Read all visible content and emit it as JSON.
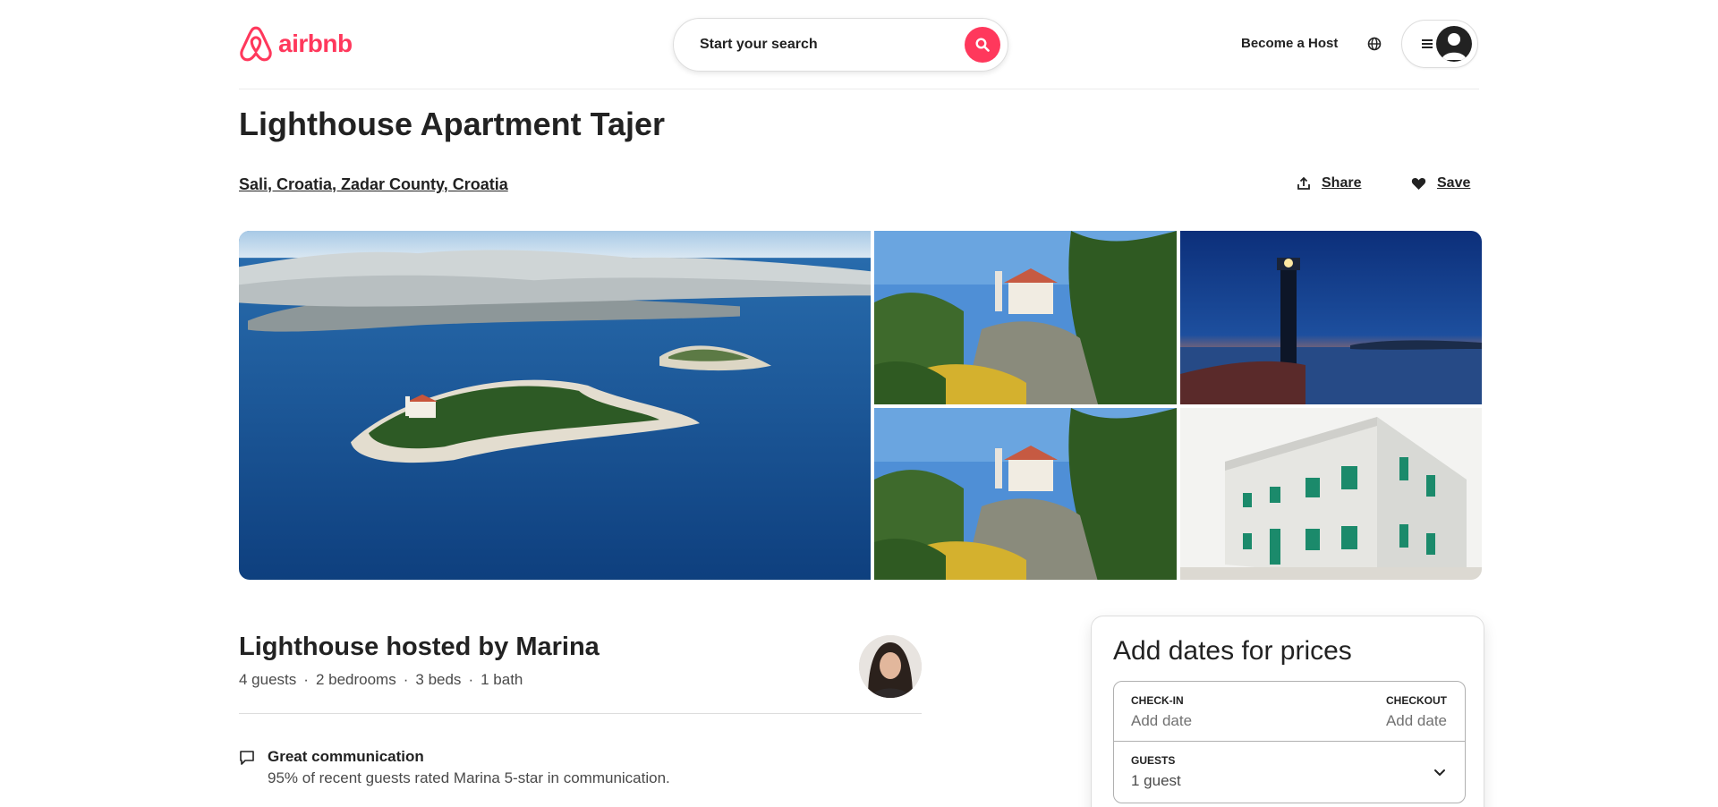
{
  "header": {
    "logo_text": "airbnb",
    "search_label": "Start your search",
    "host_link": "Become a Host"
  },
  "listing": {
    "title": "Lighthouse Apartment Tajer",
    "location": "Sali, Croatia, Zadar County, Croatia",
    "share_label": "Share",
    "save_label": "Save"
  },
  "host": {
    "title": "Lighthouse hosted by Marina",
    "details": [
      "4 guests",
      "·",
      "2 bedrooms",
      "·",
      "3 beds",
      "·",
      "1 bath"
    ],
    "highlight_title": "Great communication",
    "highlight_desc": "95% of recent guests rated Marina 5-star in communication."
  },
  "booking": {
    "title": "Add dates for prices",
    "checkin_label": "CHECK-IN",
    "checkin_value": "Add date",
    "checkout_label": "CHECKOUT",
    "checkout_value": "Add date",
    "guests_label": "GUESTS",
    "guests_value": "1 guest"
  },
  "colors": {
    "brand": "#ff385c",
    "text": "#222222",
    "muted": "#717171"
  },
  "icons": [
    "airbnb-logo-icon",
    "search-icon",
    "globe-icon",
    "menu-icon",
    "user-avatar-icon",
    "share-icon",
    "heart-icon",
    "message-icon",
    "chevron-down-icon"
  ]
}
